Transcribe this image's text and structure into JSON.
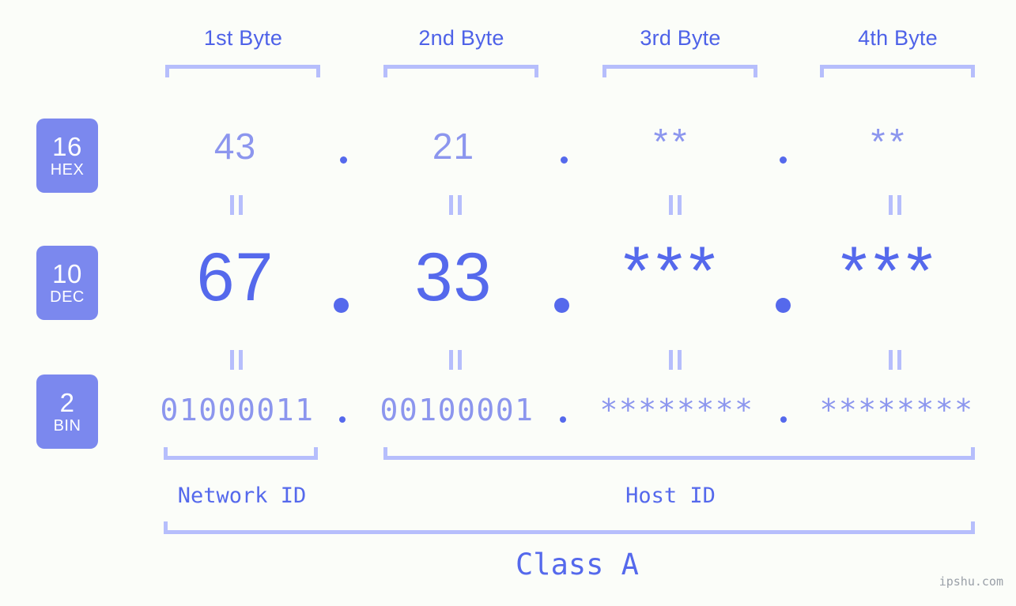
{
  "meta": {
    "background": "#fbfdf9",
    "accent_dark": "#5569ec",
    "accent_mid": "#8c96ee",
    "accent_light": "#b6befc",
    "badge_bg": "#7b88ee",
    "watermark": "ipshu.com"
  },
  "byte_headers": [
    {
      "label": "1st Byte"
    },
    {
      "label": "2nd Byte"
    },
    {
      "label": "3rd Byte"
    },
    {
      "label": "4th Byte"
    }
  ],
  "rows": [
    {
      "badge_num": "16",
      "badge_abbr": "HEX",
      "values": [
        "43",
        "21",
        "**",
        "**"
      ],
      "separator": "."
    },
    {
      "badge_num": "10",
      "badge_abbr": "DEC",
      "values": [
        "67",
        "33",
        "***",
        "***"
      ],
      "separator": "."
    },
    {
      "badge_num": "2",
      "badge_abbr": "BIN",
      "values": [
        "01000011",
        "00100001",
        "********",
        "********"
      ],
      "separator": "."
    }
  ],
  "equals_mark": "=",
  "sections": {
    "network_id": "Network ID",
    "host_id": "Host ID",
    "class": "Class A"
  },
  "chart_data": {
    "type": "table",
    "title": "IP Address Byte Breakdown",
    "categories": [
      "1st Byte",
      "2nd Byte",
      "3rd Byte",
      "4th Byte"
    ],
    "series": [
      {
        "name": "HEX (16)",
        "values": [
          "43",
          "21",
          "**",
          "**"
        ]
      },
      {
        "name": "DEC (10)",
        "values": [
          "67",
          "33",
          "***",
          "***"
        ]
      },
      {
        "name": "BIN (2)",
        "values": [
          "01000011",
          "00100001",
          "********",
          "********"
        ]
      }
    ],
    "annotations": [
      "Network ID",
      "Host ID",
      "Class A"
    ]
  }
}
